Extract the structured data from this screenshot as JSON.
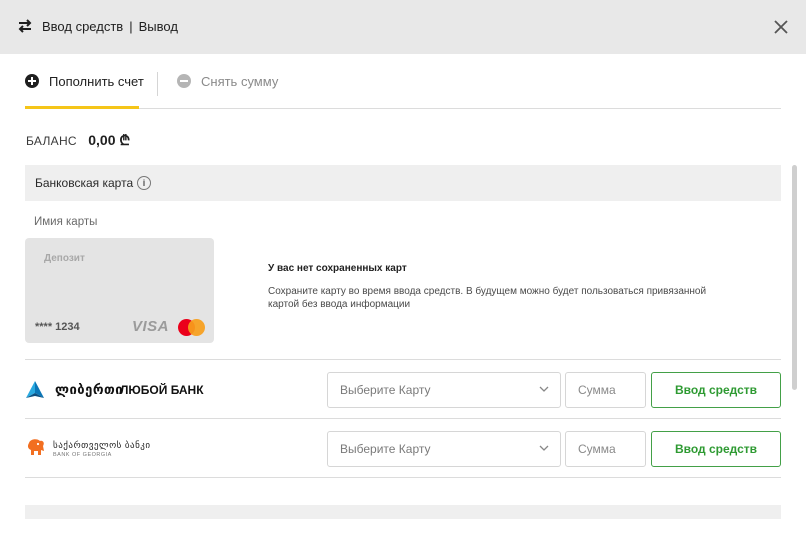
{
  "header": {
    "icon": "swap-arrows-icon",
    "title_deposit": "Ввод средств",
    "title_separator": "|",
    "title_withdraw": "Вывод",
    "close_icon": "close-icon"
  },
  "tabs": [
    {
      "label": "Пополнить счет",
      "icon": "plus-circle-icon",
      "active": true
    },
    {
      "label": "Снять сумму",
      "icon": "minus-circle-icon",
      "active": false
    }
  ],
  "balance": {
    "label": "БАЛАНС",
    "value": "0,00 ₾"
  },
  "bank_card_section": {
    "title": "Банковская карта",
    "info_icon": "i",
    "card_name_label": "Имия карты",
    "card": {
      "title": "Депозит",
      "number": "**** 1234",
      "brand1": "VISA",
      "brand2_icon": "mastercard-icon"
    },
    "no_saved": {
      "title": "У вас нет сохраненных карт",
      "description": "Сохраните карту во время ввода средств. В будущем можно будет пользоваться привязанной картой без ввода информации"
    }
  },
  "banks": [
    {
      "logo_icon": "liberty-bank-logo-icon",
      "name_geo": "ლიბერთი",
      "name_ru": "ЛЮБОЙ БАНК",
      "select_placeholder": "Выберите Карту",
      "amount_placeholder": "Сумма",
      "button_label": "Ввод средств"
    },
    {
      "logo_icon": "bank-of-georgia-lion-icon",
      "name_geo": "საქართველოს ბანკი",
      "name_en": "BANK OF GEORGIA",
      "select_placeholder": "Выберите Карту",
      "amount_placeholder": "Сумма",
      "button_label": "Ввод средств"
    }
  ],
  "colors": {
    "accent": "#f5c518",
    "button_green": "#2e9a32",
    "header_bg": "#e8e8e8",
    "section_bg": "#efefef"
  }
}
